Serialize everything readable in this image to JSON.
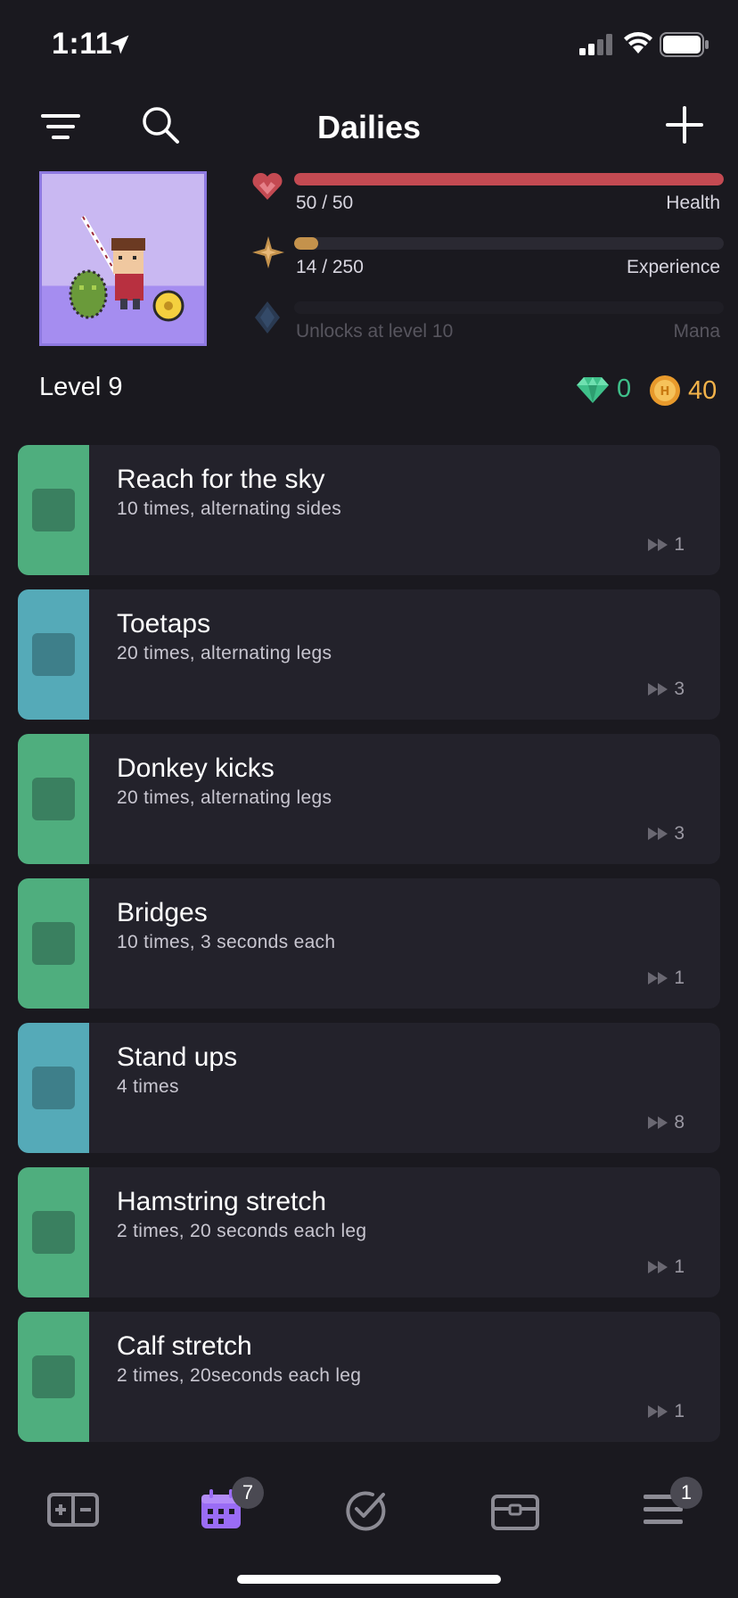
{
  "status_bar": {
    "time": "1:11"
  },
  "header": {
    "title": "Dailies"
  },
  "stats": {
    "health": {
      "value": "50 / 50",
      "label": "Health",
      "fraction": 1.0,
      "color": "#c44a52"
    },
    "experience": {
      "value": "14 / 250",
      "label": "Experience",
      "fraction": 0.056,
      "color": "#c4924c"
    },
    "mana": {
      "value": "Unlocks at level 10",
      "label": "Mana"
    }
  },
  "profile": {
    "level": "Level 9",
    "gems": "0",
    "gold": "40"
  },
  "tasks": [
    {
      "title": "Reach for the sky",
      "notes": "10 times, alternating sides",
      "streak": "1",
      "color": "#4fae7e",
      "check_color": "#3a8060"
    },
    {
      "title": "Toetaps",
      "notes": "20 times, alternating legs",
      "streak": "3",
      "color": "#55aab8",
      "check_color": "#3e7f8a"
    },
    {
      "title": "Donkey kicks",
      "notes": "20 times, alternating legs",
      "streak": "3",
      "color": "#4fae7e",
      "check_color": "#3a8060"
    },
    {
      "title": "Bridges",
      "notes": "10 times, 3 seconds each",
      "streak": "1",
      "color": "#4fae7e",
      "check_color": "#3a8060"
    },
    {
      "title": "Stand ups",
      "notes": "4 times",
      "streak": "8",
      "color": "#55aab8",
      "check_color": "#3e7f8a"
    },
    {
      "title": "Hamstring stretch",
      "notes": "2 times, 20 seconds each leg",
      "streak": "1",
      "color": "#4fae7e",
      "check_color": "#3a8060"
    },
    {
      "title": "Calf stretch",
      "notes": "2 times, 20seconds each leg",
      "streak": "1",
      "color": "#4fae7e",
      "check_color": "#3a8060"
    }
  ],
  "tab_bar": {
    "tabs": [
      {
        "name": "habits",
        "icon": "habits-icon"
      },
      {
        "name": "dailies",
        "icon": "calendar-icon",
        "badge": "7",
        "active": true
      },
      {
        "name": "todos",
        "icon": "check-circle-icon"
      },
      {
        "name": "rewards",
        "icon": "chest-icon"
      },
      {
        "name": "menu",
        "icon": "menu-icon",
        "badge": "1"
      }
    ]
  },
  "colors": {
    "accent": "#9a6cf5",
    "background": "#1a191f",
    "card": "#23222b"
  }
}
